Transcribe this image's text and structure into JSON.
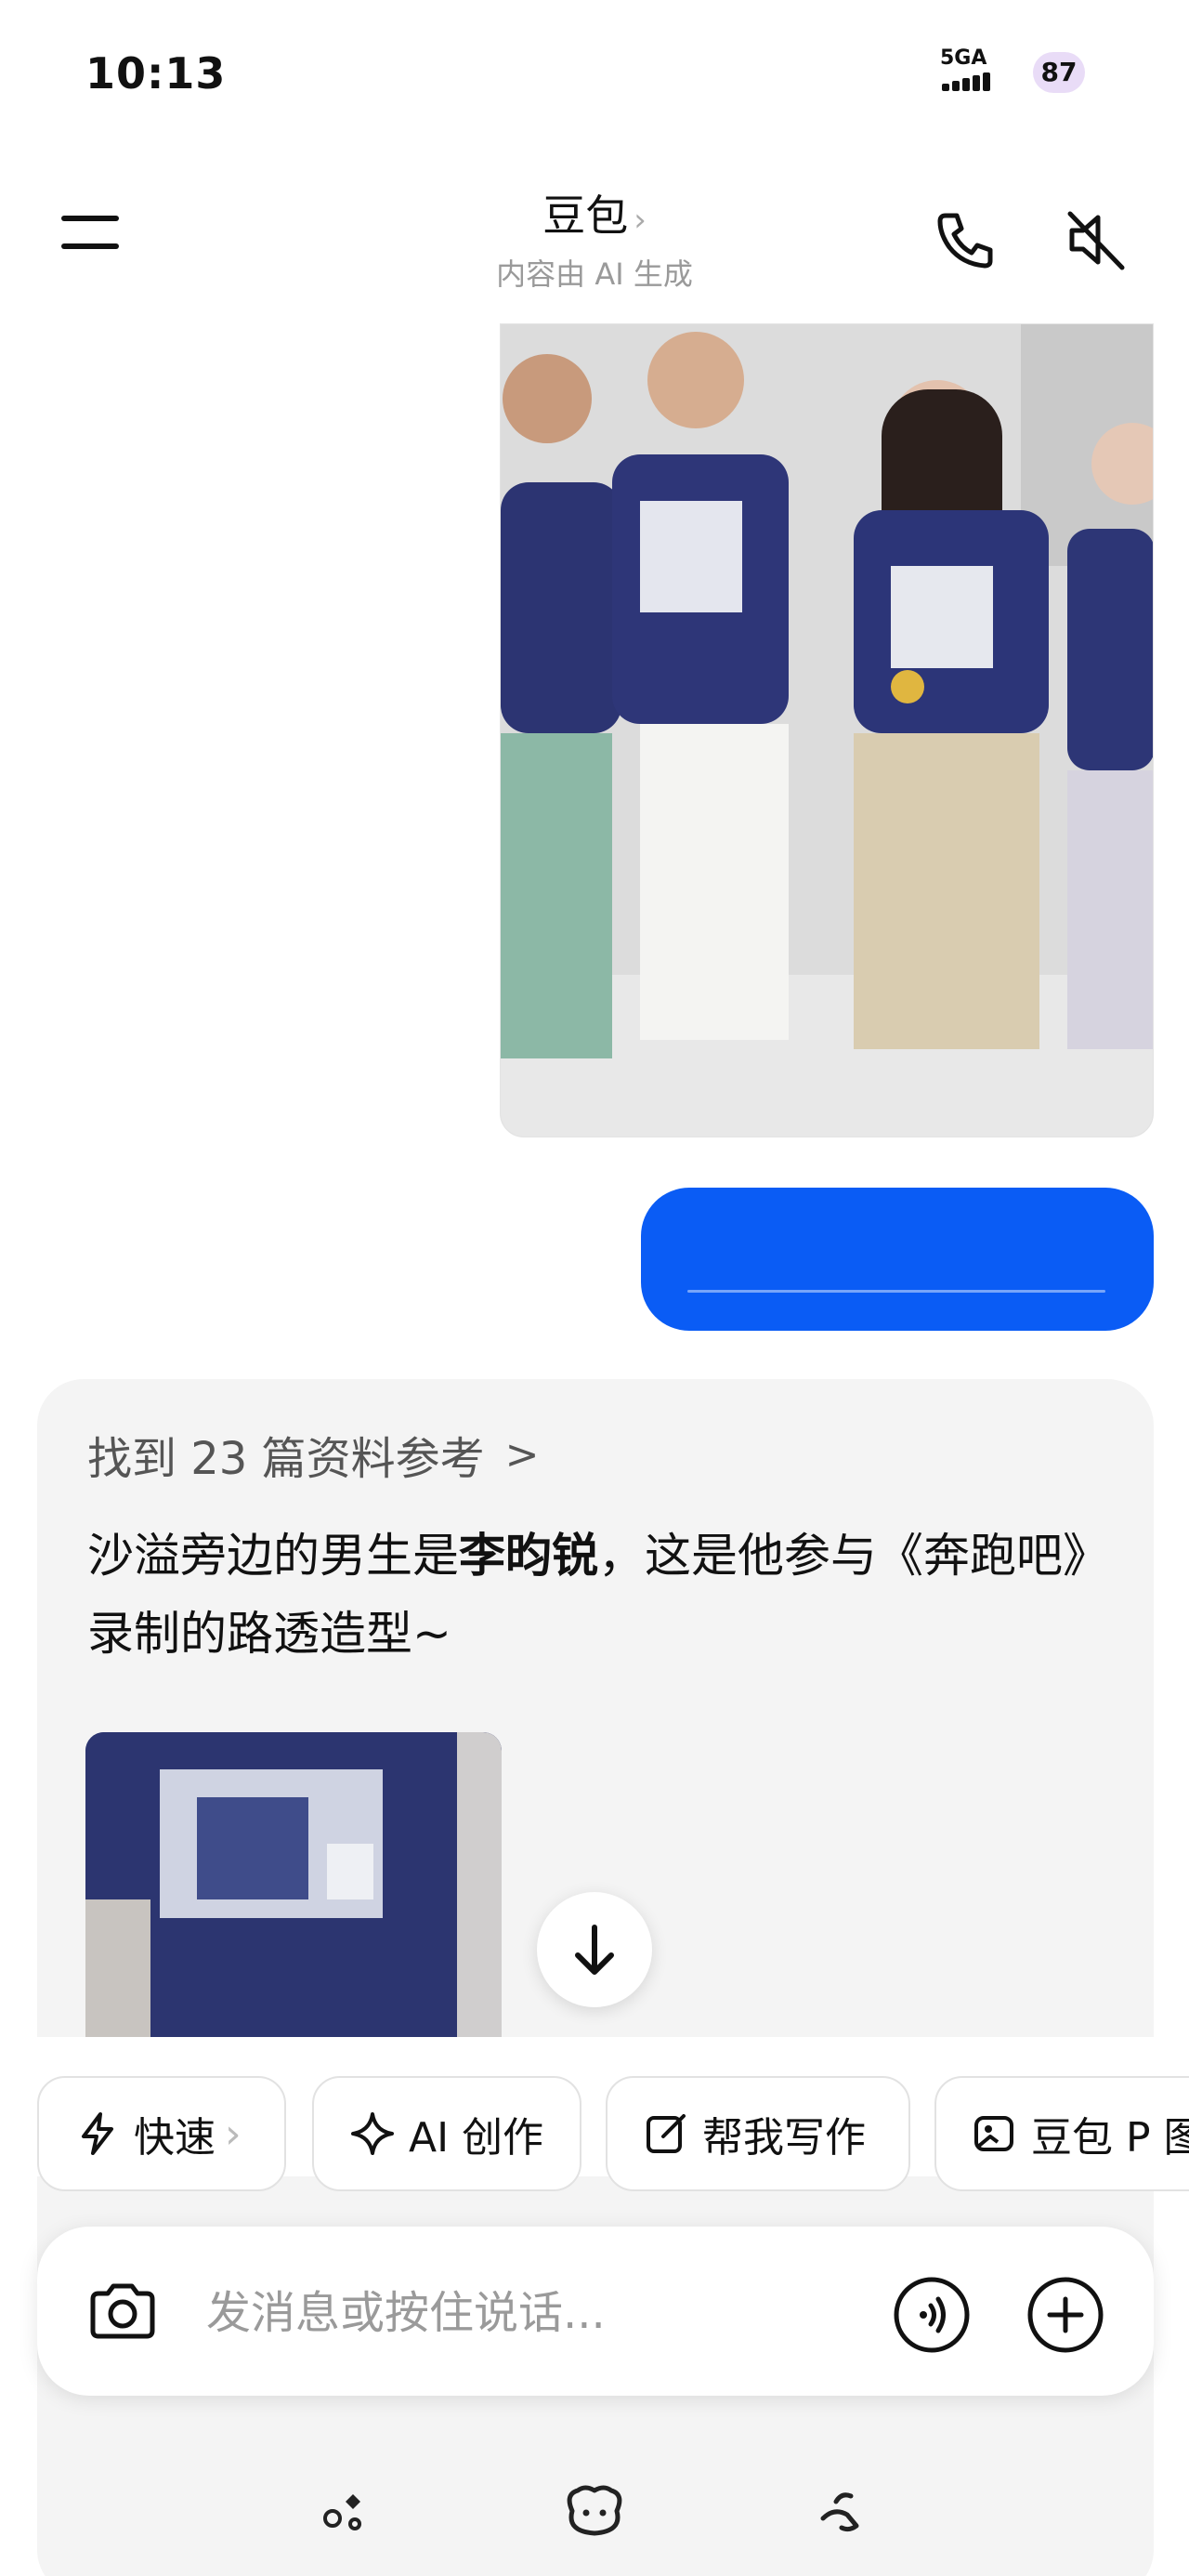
{
  "status_bar": {
    "time": "10:13",
    "network": "5GA",
    "battery": "87"
  },
  "header": {
    "title": "豆包",
    "title_chevron": "›",
    "subtitle": "内容由 AI 生成",
    "icons": [
      "menu-icon",
      "phone-icon",
      "speaker-muted-icon"
    ]
  },
  "chat": {
    "user_message_image": "photo of four people in navy T-shirts",
    "user_message_text": "",
    "reply": {
      "references": "找到 23 篇资料参考",
      "references_chevron": ">",
      "answer_before": "沙溢旁边的男生是",
      "answer_bold": "李昀锐",
      "answer_after": "，这是他参与《奔跑吧》录制的路透造型~"
    }
  },
  "chips": [
    {
      "label": "快速",
      "icon": "lightning-icon",
      "chevron": "›"
    },
    {
      "label": "AI 创作",
      "icon": "sparkle-icon"
    },
    {
      "label": "帮我写作",
      "icon": "edit-icon"
    },
    {
      "label": "豆包 P 图",
      "icon": "image-edit-icon"
    }
  ],
  "input": {
    "placeholder": "发消息或按住说话..."
  },
  "bottom_nav": [
    "discover-icon",
    "doubao-avatar-icon",
    "phone-call-icon"
  ],
  "colors": {
    "accent": "#0a5cf5",
    "card_bg": "#f4f4f4",
    "battery_bg": "#e9dcf7"
  }
}
